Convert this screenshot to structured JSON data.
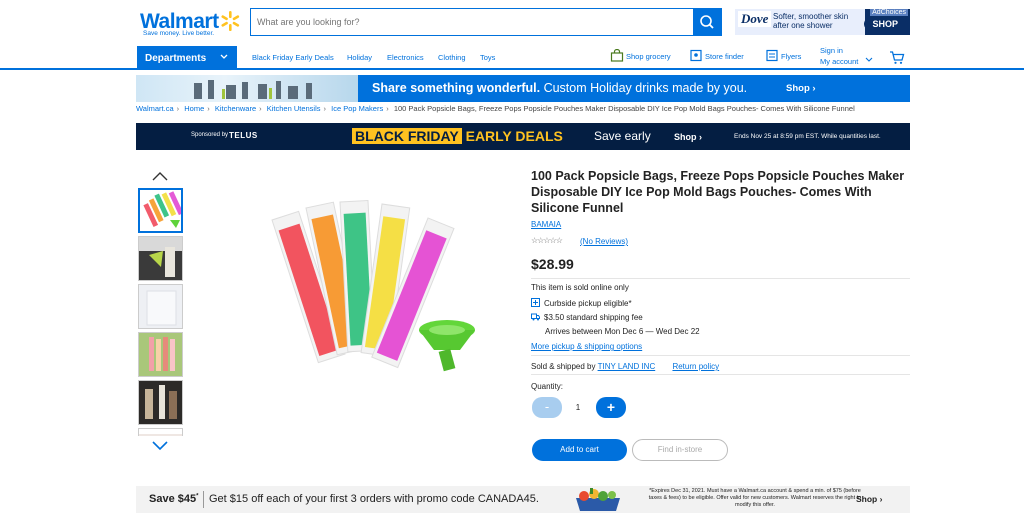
{
  "header": {
    "logo_text": "Walmart",
    "logo_tagline": "Save money. Live better.",
    "search_placeholder": "What are you looking for?",
    "ad": {
      "brand": "Dove",
      "line1": "Softer, smoother skin",
      "line2": "after one shower",
      "adchoices": "AdChoices",
      "shop": "SHOP"
    },
    "departments_label": "Departments",
    "nav_links": [
      "Black Friday Early Deals",
      "Holiday",
      "Electronics",
      "Clothing",
      "Toys"
    ],
    "shop_grocery": "Shop grocery",
    "store_finder": "Store finder",
    "flyers": "Flyers",
    "sign_in": "Sign in",
    "my_account": "My account"
  },
  "holiday_banner": {
    "bold": "Share something wonderful.",
    "rest": "Custom Holiday drinks made by you.",
    "shop": "Shop ›"
  },
  "breadcrumbs": [
    "Walmart.ca",
    "Home",
    "Kitchenware",
    "Kitchen Utensils",
    "Ice Pop Makers",
    "100 Pack Popsicle Bags, Freeze Pops Popsicle Pouches Maker Disposable DIY Ice Pop Mold Bags Pouches- Comes With Silicone Funnel"
  ],
  "bf_banner": {
    "sponsored": "Sponsored by",
    "sponsor": "TELUS",
    "black_friday": "BLACK FRIDAY",
    "early_deals": "EARLY DEALS",
    "save": "Save early",
    "shop": "Shop ›",
    "ends": "Ends Nov 25 at 8:59 pm EST. While quantities last."
  },
  "product": {
    "title": "100 Pack Popsicle Bags, Freeze Pops Popsicle Pouches Maker Disposable DIY Ice Pop Mold Bags Pouches- Comes With Silicone Funnel",
    "brand": "BAMAIA",
    "reviews": "(No Reviews)",
    "price": "$28.99",
    "online_only": "This item is sold online only",
    "curbside": "Curbside pickup eligible*",
    "shipping": "$3.50 standard shipping fee",
    "arrives": "Arrives between Mon Dec 6 — Wed Dec 22",
    "more_options": "More pickup & shipping options",
    "sold_by_prefix": "Sold & shipped by",
    "seller": "TINY LAND INC",
    "return_policy": "Return policy",
    "quantity_label": "Quantity:",
    "quantity": "1",
    "minus": "-",
    "plus": "+",
    "add_to_cart": "Add to cart",
    "find_in_store": "Find in-store"
  },
  "promo": {
    "save": "Save $45",
    "sup": "*",
    "message": "Get $15 off each of your first 3 orders with promo code CANADA45.",
    "fine_print": "*Expires Dec 31, 2021. Must have a Walmart.ca account & spend a min. of $75 (before taxes & fees) to be eligible. Offer valid for new customers. Walmart reserves the right to modify this offer.",
    "shop": "Shop ›"
  },
  "colors": {
    "brand_blue": "#0071dc",
    "navy": "#041e42",
    "spark_yellow": "#ffc220"
  }
}
